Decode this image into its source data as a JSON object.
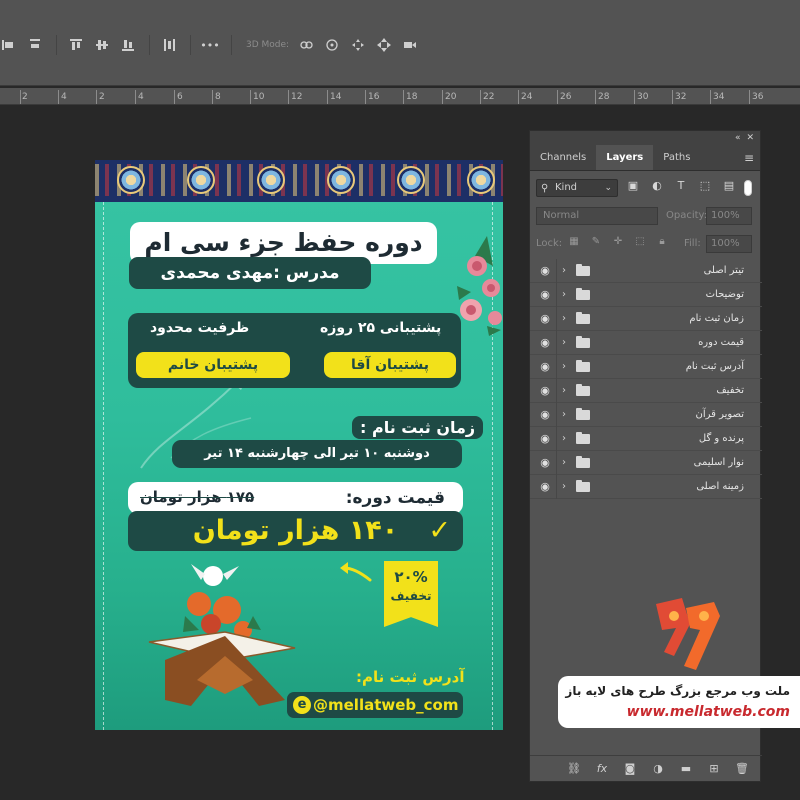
{
  "options_bar": {
    "mode_label": "3D Mode:"
  },
  "ruler": {
    "ticks": [
      "2",
      "4",
      "2",
      "4",
      "6",
      "8",
      "10",
      "12",
      "14",
      "16",
      "18",
      "20",
      "22",
      "24",
      "26",
      "28",
      "30",
      "32",
      "34",
      "36"
    ]
  },
  "poster": {
    "title": "دوره حفظ جزء سی ام",
    "teacher": "مدرس :مهدی محمدی",
    "features": {
      "support_days": "پشتیبانی ۲۵ روزه",
      "capacity": "ظرفیت محدود",
      "male_support": "پشتیبان آقا",
      "female_support": "پشتیبان خانم"
    },
    "registration_label": "زمان ثبت نام :",
    "registration_time": "دوشنبه ۱۰ تیر الی چهارشنبه ۱۴ تیر",
    "price_label": "قیمت دوره:",
    "price_old": "۱۷۵ هزار تومان",
    "price_new": "۱۴۰ هزار تومان",
    "discount_percent": "۲۰%",
    "discount_label": "تخفیف",
    "address_label": "آدرس ثبت نام:",
    "address_handle": "@mellatweb_com",
    "colors": {
      "teal": "#2fbd9c",
      "dark": "#1e4a45",
      "yellow": "#f2e11a"
    }
  },
  "panel": {
    "tabs": [
      "Channels",
      "Layers",
      "Paths"
    ],
    "active_tab": "Layers",
    "filter_kind": "Kind",
    "blend_mode": "Normal",
    "opacity_label": "Opacity:",
    "opacity_value": "100%",
    "lock_label": "Lock:",
    "fill_label": "Fill:",
    "fill_value": "100%",
    "layers": [
      "تیتر اصلی",
      "توضیحات",
      "زمان ثبت نام",
      "قیمت دوره",
      "آدرس ثبت نام",
      "تخفیف",
      "تصویر قرآن",
      "پرنده و گل",
      "نوار اسلیمی",
      "زمینه اصلی"
    ]
  },
  "watermark": {
    "line1": "ملت وب مرجع بزرگ طرح های لایه باز",
    "line2": "www.mellatweb.com"
  }
}
